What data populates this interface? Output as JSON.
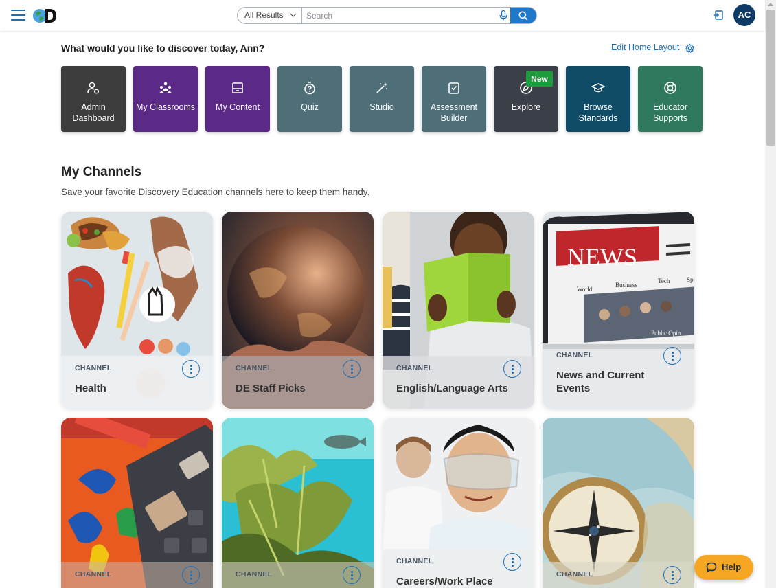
{
  "header": {
    "search_scope": "All Results",
    "search_placeholder": "Search",
    "avatar_initials": "AC"
  },
  "greeting": "What would you like to discover today, Ann?",
  "edit_layout_label": "Edit Home Layout",
  "tiles": [
    {
      "label": "Admin Dashboard",
      "icon": "admin-user-gear-icon",
      "color": "#3d3d3d"
    },
    {
      "label": "My Classrooms",
      "icon": "classroom-people-icon",
      "color": "#5b2a86"
    },
    {
      "label": "My Content",
      "icon": "content-folder-icon",
      "color": "#5b2a86"
    },
    {
      "label": "Quiz",
      "icon": "quiz-stopwatch-icon",
      "color": "#4f6f78"
    },
    {
      "label": "Studio",
      "icon": "studio-wand-icon",
      "color": "#4f6f78"
    },
    {
      "label": "Assessment Builder",
      "icon": "assessment-clipboard-icon",
      "color": "#4f6f78"
    },
    {
      "label": "Explore",
      "icon": "explore-compass-icon",
      "color": "#3b3f48"
    },
    {
      "label": "Browse Standards",
      "icon": "graduation-cap-icon",
      "color": "#0f4a66"
    },
    {
      "label": "Educator Supports",
      "icon": "lifebuoy-icon",
      "color": "#2f7a5e"
    }
  ],
  "new_badge": "New",
  "channels_section": {
    "title": "My Channels",
    "subtitle": "Save your favorite Discovery Education channels here to keep them handy."
  },
  "channels": [
    {
      "label": "CHANNEL",
      "title": "Health"
    },
    {
      "label": "CHANNEL",
      "title": "DE Staff Picks"
    },
    {
      "label": "CHANNEL",
      "title": "English/Language Arts"
    },
    {
      "label": "CHANNEL",
      "title": "News and Current Events"
    },
    {
      "label": "CHANNEL",
      "title": ""
    },
    {
      "label": "CHANNEL",
      "title": ""
    },
    {
      "label": "CHANNEL",
      "title": "Careers/Work Place"
    },
    {
      "label": "CHANNEL",
      "title": ""
    }
  ],
  "news_image_text": {
    "headline": "NEWS",
    "tabs": [
      "World",
      "Business",
      "Tech",
      "Sp"
    ],
    "caption": "Public Opin"
  },
  "help_label": "Help",
  "colors": {
    "accent": "#1f6fb4",
    "help": "#f5a623",
    "new_badge": "#1e9b3d",
    "avatar": "#0d3b66"
  }
}
